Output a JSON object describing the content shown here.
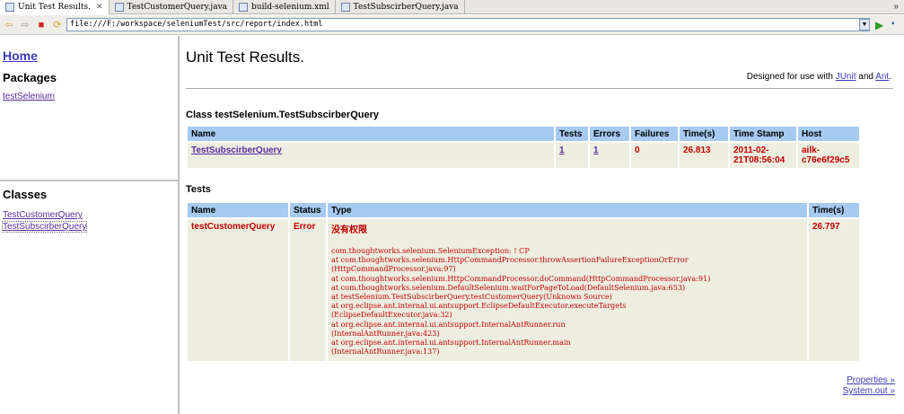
{
  "tabs": [
    {
      "label": "Unit Test Results.",
      "close": "✕",
      "active": true
    },
    {
      "label": "TestCustomerQuery.java",
      "active": false
    },
    {
      "label": "build-selenium.xml",
      "active": false
    },
    {
      "label": "TestSubscirberQuery.java",
      "active": false
    }
  ],
  "tabs_overflow": "»",
  "toolbar": {
    "back_icon": "⇦",
    "forward_icon": "⇨",
    "stop_icon": "■",
    "refresh_icon": "⟳",
    "url": "file:///F:/workspace/seleniumTest/src/report/index.html",
    "dropdown_icon": "▼",
    "go_icon": "▶",
    "stop2_icon": "▪"
  },
  "sidebar": {
    "home": "Home",
    "packages_heading": "Packages",
    "packages": [
      "testSelenium"
    ],
    "classes_heading": "Classes",
    "classes": [
      "TestCustomerQuery",
      "TestSubscirberQuery"
    ]
  },
  "report": {
    "title": "Unit Test Results.",
    "designed_prefix": "Designed for use with ",
    "junit": "JUnit",
    "and": " and ",
    "ant": "Ant",
    "period": ".",
    "class_heading": "Class testSelenium.TestSubscirberQuery",
    "class_table": {
      "headers": [
        "Name",
        "Tests",
        "Errors",
        "Failures",
        "Time(s)",
        "Time Stamp",
        "Host"
      ],
      "row": {
        "name": "TestSubscirberQuery",
        "tests": "1",
        "errors": "1",
        "failures": "0",
        "time": "26.813",
        "timestamp_line1": "2011-02-",
        "timestamp_line2": "21T08:56:04",
        "host_line1": "ailk-",
        "host_line2": "c76e6f29c5"
      }
    },
    "tests_heading": "Tests",
    "tests_table": {
      "headers": [
        "Name",
        "Status",
        "Type",
        "Time(s)"
      ],
      "row": {
        "name": "testCustomerQuery",
        "status": "Error",
        "message": "没有权限",
        "trace": [
          "com.thoughtworks.selenium.SeleniumException: ! CP",
          "at com.thoughtworks.selenium.HttpCommandProcessor.throwAssertionFailureExceptionOrError",
          "(HttpCommandProcessor.java:97)",
          "at com.thoughtworks.selenium.HttpCommandProcessor.doCommand(HttpCommandProcessor.java:91)",
          "at com.thoughtworks.selenium.DefaultSelenium.waitForPageToLoad(DefaultSelenium.java:653)",
          "at testSelenium.TestSubscirberQuery.testCustomerQuery(Unknown Source)",
          "at org.eclipse.ant.internal.ui.antsupport.EclipseDefaultExecutor.executeTargets",
          "(EclipseDefaultExecutor.java:32)",
          "at org.eclipse.ant.internal.ui.antsupport.InternalAntRunner.run",
          "(InternalAntRunner.java:423)",
          "at org.eclipse.ant.internal.ui.antsupport.InternalAntRunner.main",
          "(InternalAntRunner.java:137)"
        ],
        "time": "26.797"
      }
    },
    "properties_link": "Properties »",
    "system_out_link": "System.out »"
  }
}
